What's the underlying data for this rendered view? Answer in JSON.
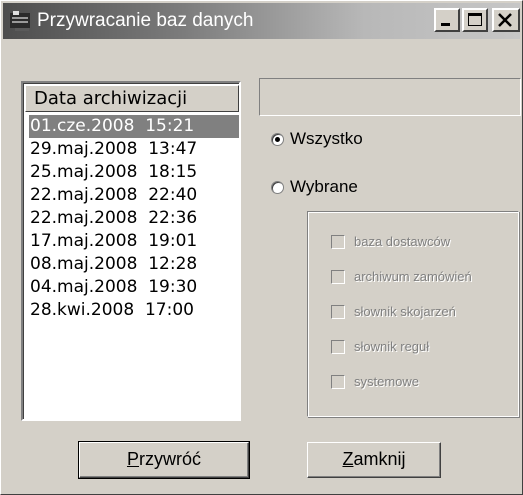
{
  "window": {
    "title": "Przywracanie baz danych",
    "icon": "app-icon"
  },
  "list": {
    "header": "Data archiwizacji",
    "items": [
      "01.cze.2008  15:21",
      "29.maj.2008  13:47",
      "25.maj.2008  18:15",
      "22.maj.2008  22:40",
      "22.maj.2008  22:36",
      "17.maj.2008  19:01",
      "08.maj.2008  12:28",
      "04.maj.2008  19:30",
      "28.kwi.2008  17:00"
    ],
    "selected_index": 0
  },
  "field": {
    "value": ""
  },
  "scope": {
    "all_label": "Wszystko",
    "selected_label": "Wybrane",
    "checked": "all"
  },
  "options": [
    {
      "label": "baza dostawców",
      "checked": false,
      "enabled": false
    },
    {
      "label": "archiwum zamówień",
      "checked": false,
      "enabled": false
    },
    {
      "label": "słownik skojarzeń",
      "checked": false,
      "enabled": false
    },
    {
      "label": "słownik reguł",
      "checked": false,
      "enabled": false
    },
    {
      "label": "systemowe",
      "checked": false,
      "enabled": false
    }
  ],
  "buttons": {
    "restore_accel": "P",
    "restore_rest": "rzywróć",
    "close_accel": "Z",
    "close_rest": "amknij"
  },
  "colors": {
    "face": "#d4d0c8",
    "selection": "#808080",
    "disabled_text": "#808080"
  }
}
